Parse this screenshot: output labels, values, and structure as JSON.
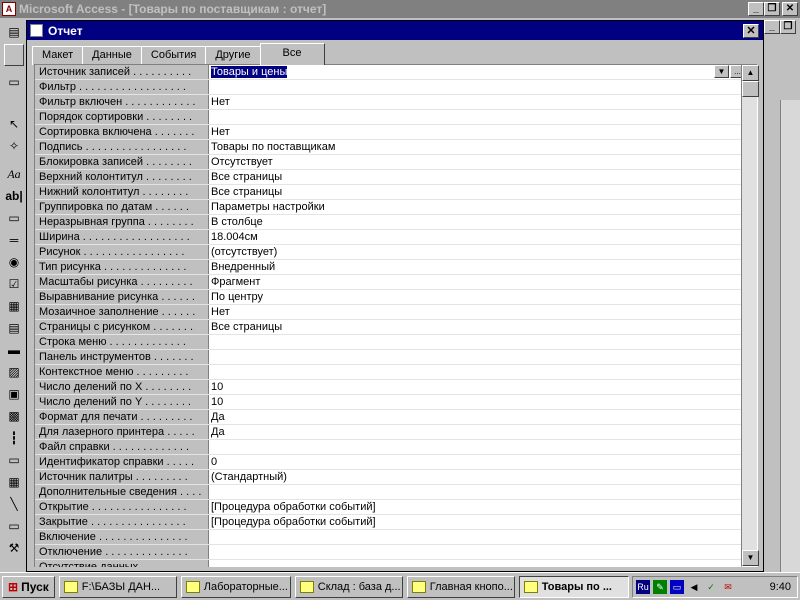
{
  "app": {
    "title": "Microsoft Access - [Товары по поставщикам : отчет]"
  },
  "props": {
    "title": "Отчет",
    "tabs": [
      "Макет",
      "Данные",
      "События",
      "Другие",
      "Все"
    ],
    "active_tab": "Все",
    "rows": [
      {
        "label": "Источник записей . . . . . . . . . .",
        "value": "Товары и цены",
        "selected": true
      },
      {
        "label": "Фильтр . . . . . . . . . . . . . . . . . .",
        "value": ""
      },
      {
        "label": "Фильтр включен . . . . . . . . . . . .",
        "value": "Нет"
      },
      {
        "label": "Порядок сортировки . . . . . . . .",
        "value": ""
      },
      {
        "label": "Сортировка включена . . . . . . .",
        "value": "Нет"
      },
      {
        "label": "Подпись . . . . . . . . . . . . . . . . .",
        "value": "Товары по поставщикам"
      },
      {
        "label": "Блокировка записей . . . . . . . .",
        "value": "Отсутствует"
      },
      {
        "label": "Верхний колонтитул . . . . . . . .",
        "value": "Все страницы"
      },
      {
        "label": "Нижний колонтитул . . . . . . . .",
        "value": "Все страницы"
      },
      {
        "label": "Группировка по датам . . . . . .",
        "value": "Параметры настройки"
      },
      {
        "label": "Неразрывная группа . . . . . . . .",
        "value": "В столбце"
      },
      {
        "label": "Ширина . . . . . . . . . . . . . . . . . .",
        "value": "18.004см"
      },
      {
        "label": "Рисунок . . . . . . . . . . . . . . . . .",
        "value": "(отсутствует)"
      },
      {
        "label": "Тип рисунка . . . . . . . . . . . . . .",
        "value": "Внедренный"
      },
      {
        "label": "Масштабы рисунка . . . . . . . . .",
        "value": "Фрагмент"
      },
      {
        "label": "Выравнивание рисунка . . . . . .",
        "value": "По центру"
      },
      {
        "label": "Мозаичное заполнение . . . . . .",
        "value": "Нет"
      },
      {
        "label": "Страницы с рисунком . . . . . . .",
        "value": "Все страницы"
      },
      {
        "label": "Строка меню . . . . . . . . . . . . .",
        "value": ""
      },
      {
        "label": "Панель инструментов . . . . . . .",
        "value": ""
      },
      {
        "label": "Контекстное меню . . . . . . . . .",
        "value": ""
      },
      {
        "label": "Число делений по X . . . . . . . .",
        "value": "10"
      },
      {
        "label": "Число делений по Y . . . . . . . .",
        "value": "10"
      },
      {
        "label": "Формат для печати . . . . . . . . .",
        "value": "Да"
      },
      {
        "label": "Для лазерного принтера . . . . .",
        "value": "Да"
      },
      {
        "label": "Файл справки . . . . . . . . . . . . .",
        "value": ""
      },
      {
        "label": "Идентификатор справки . . . . .",
        "value": "0"
      },
      {
        "label": "Источник палитры . . . . . . . . .",
        "value": "(Стандартный)"
      },
      {
        "label": "Дополнительные сведения . . . .",
        "value": ""
      },
      {
        "label": "Открытие . . . . . . . . . . . . . . . .",
        "value": "[Процедура обработки событий]"
      },
      {
        "label": "Закрытие . . . . . . . . . . . . . . . .",
        "value": "[Процедура обработки событий]"
      },
      {
        "label": "Включение . . . . . . . . . . . . . . .",
        "value": ""
      },
      {
        "label": "Отключение . . . . . . . . . . . . . .",
        "value": ""
      },
      {
        "label": "Отсутствие данных . . . . . . . .",
        "value": ""
      }
    ]
  },
  "taskbar": {
    "start_label": "Пуск",
    "tasks": [
      {
        "label": "F:\\БАЗЫ ДАН..."
      },
      {
        "label": "Лабораторные..."
      },
      {
        "label": "Склад : база д..."
      },
      {
        "label": "Главная кнопо..."
      },
      {
        "label": "Товары по ...",
        "active": true
      }
    ],
    "tray_lang": "Ru",
    "clock": "9:40"
  }
}
